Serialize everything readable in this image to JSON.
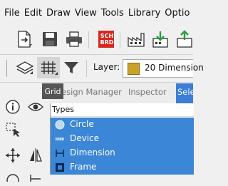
{
  "menu": [
    "File",
    "Edit",
    "Draw",
    "View",
    "Tools",
    "Library",
    "Optio"
  ],
  "toolbar": {
    "sch_brd_label_top": "SCH",
    "sch_brd_label_bottom": "BRD"
  },
  "toolbar2": {
    "layer_label": "Layer:",
    "layer_value": "20 Dimension",
    "layer_color": "#c9a227"
  },
  "tooltip": "Grid",
  "tabs": [
    "esign Manager",
    "Inspector",
    "Sele"
  ],
  "panel": {
    "header": "Types",
    "items": [
      {
        "label": "Circle",
        "icon": "circle-icon"
      },
      {
        "label": "Device",
        "icon": "device-icon"
      },
      {
        "label": "Dimension",
        "icon": "dimension-icon"
      },
      {
        "label": "Frame",
        "icon": "frame-icon"
      }
    ]
  },
  "colors": {
    "selection": "#3b86d6",
    "accent_tab": "#3b7dd8"
  }
}
